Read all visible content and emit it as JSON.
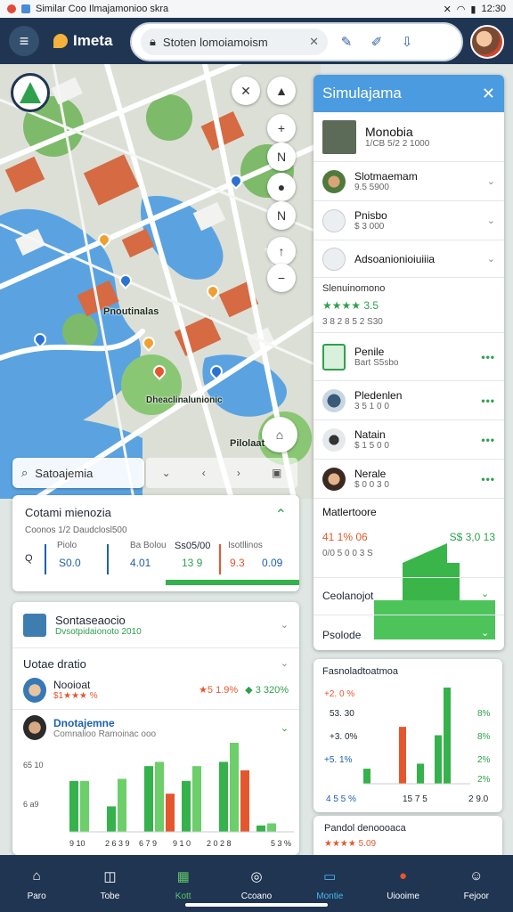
{
  "status_bar": {
    "app_label": "Similar Coo Ilmajamonioo skra",
    "time": "12:30"
  },
  "app": {
    "name": "Imeta",
    "search_placeholder": "Stoten lomoiamoism"
  },
  "map": {
    "labels": [
      "Pnoutinalas",
      "Dheaclinalunionic",
      "Pilolaat"
    ],
    "search_text": "Satoajemia"
  },
  "right_panel": {
    "title": "Simulajama",
    "featured": {
      "title": "Monobia",
      "sub": "1/CB 5/2 2 1000"
    },
    "items": [
      {
        "title": "Slotmaemam",
        "sub": "9.5 5900"
      },
      {
        "title": "Pnisbo",
        "sub": "$ 3 000"
      },
      {
        "title": "Adsoanionioiuiiia",
        "sub": ""
      }
    ],
    "section_label": "Slenuinomono",
    "rating_text": "★★★★ 3.5",
    "rating_sub": "3 8 2 8 5 2 S30",
    "items2": [
      {
        "title": "Penile",
        "sub": "Bart S5sbo"
      },
      {
        "title": "Pledenlen",
        "sub": "3 5 1 0 0"
      },
      {
        "title": "Natain",
        "sub": "$ 1 5 0 0"
      },
      {
        "title": "Nerale",
        "sub": "$ 0 0 3 0"
      }
    ],
    "stats_label": "Matlertoore",
    "stats_value_left": "41 1% 06",
    "stats_sub": "0/0 5 0 0 3 S",
    "stats_value_right": "S$ 3,0 13",
    "rows": [
      {
        "title": "Ceolanojot"
      },
      {
        "title": "Psolode"
      }
    ]
  },
  "summary_card": {
    "title": "Cotami mienozia",
    "sub": "Coonos 1/2 Daudclosl500",
    "col_heads": [
      "Piolo",
      "Ba Bolou",
      "Ss05/00",
      "Isotllinos"
    ],
    "values": [
      "S0.0",
      "4.01",
      "13 9",
      "9.3",
      "0.09"
    ],
    "q_label": "Q"
  },
  "left_card": {
    "header_title": "Sontaseaocio",
    "header_sub": "Dvsotpidaionoto 2010",
    "section_title": "Uotae dratio",
    "profile1": {
      "name": "Nooioat",
      "rating": "$1★★★ %",
      "pct_orange": "★5 1.9%",
      "pct_green": "◆ 3 320%"
    },
    "profile2": {
      "name": "Dnotajemne",
      "sub": "Comnalioo Ramoinac ooo"
    },
    "y_ticks": [
      "65 10",
      "4 8",
      "6 a9"
    ],
    "x_ticks": [
      "9 10",
      "2 6 3 9",
      "6 7 9",
      "9 1 0",
      "2 0 2 8",
      "5 3 %"
    ],
    "chart_data": {
      "type": "bar",
      "categories": [
        "9.10",
        "2639",
        "6791",
        "9.10",
        "2028",
        "53%"
      ],
      "series": [
        {
          "values": [
            48,
            24,
            62,
            48,
            66,
            6
          ]
        },
        {
          "values": [
            48,
            50,
            66,
            62,
            84,
            8
          ]
        },
        {
          "values": [
            0,
            0,
            36,
            0,
            58,
            0
          ]
        }
      ],
      "colors": [
        "#35b24b",
        "#6ccf6a",
        "#e4572e"
      ]
    }
  },
  "right_chart_card": {
    "title": "Fasnoladtoatmoa",
    "y_left": [
      "+2. 0 %",
      "53. 30",
      "+3. 0%",
      "+5. 1%",
      "4 5 5 %"
    ],
    "y_right": [
      "8%",
      "8%",
      "2%",
      "2%",
      "2 9.0"
    ],
    "x_labels": [
      "15 7 5",
      "2 5 5"
    ],
    "chart_data": {
      "type": "bar",
      "categories": [
        "a",
        "b",
        "c",
        "d"
      ],
      "series": [
        {
          "values": [
            18,
            0,
            24,
            115
          ]
        },
        {
          "values": [
            0,
            68,
            0,
            0
          ]
        },
        {
          "values": [
            0,
            0,
            58,
            0
          ]
        }
      ],
      "colors": [
        "#35b24b",
        "#e4572e"
      ]
    }
  },
  "small_card": {
    "title": "Pandol denoooaca",
    "stars": "★★★★ 5.09"
  },
  "bottom_nav": [
    {
      "label": "Paro",
      "icon": "home-icon"
    },
    {
      "label": "Tobe",
      "icon": "bag-icon"
    },
    {
      "label": "Kott",
      "icon": "grid-icon"
    },
    {
      "label": "Ccoano",
      "icon": "compass-icon"
    },
    {
      "label": "Montie",
      "icon": "chat-icon",
      "active": true
    },
    {
      "label": "Uiooime",
      "icon": "flame-icon"
    },
    {
      "label": "Fejoor",
      "icon": "person-icon"
    }
  ]
}
